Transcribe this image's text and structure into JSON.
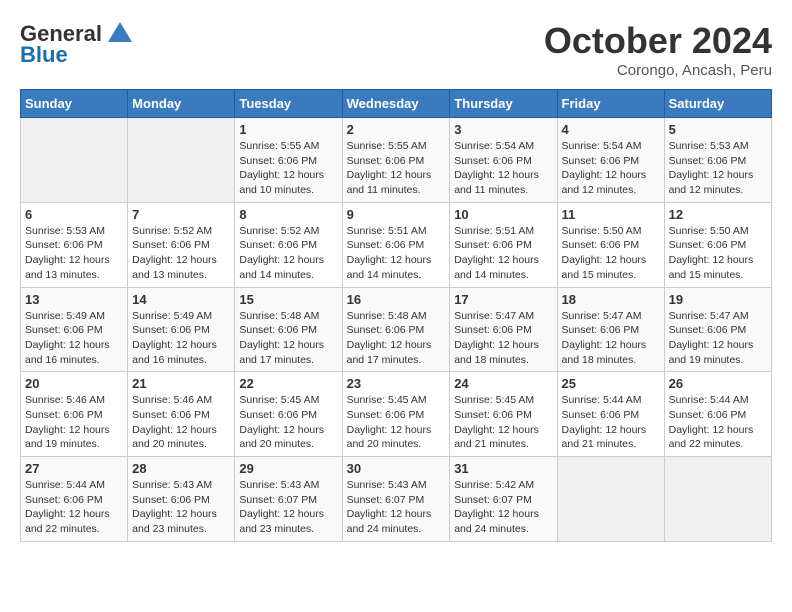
{
  "header": {
    "logo_general": "General",
    "logo_blue": "Blue",
    "month_title": "October 2024",
    "location": "Corongo, Ancash, Peru"
  },
  "weekdays": [
    "Sunday",
    "Monday",
    "Tuesday",
    "Wednesday",
    "Thursday",
    "Friday",
    "Saturday"
  ],
  "weeks": [
    [
      {
        "day": null
      },
      {
        "day": null
      },
      {
        "day": "1",
        "sunrise": "Sunrise: 5:55 AM",
        "sunset": "Sunset: 6:06 PM",
        "daylight": "Daylight: 12 hours and 10 minutes."
      },
      {
        "day": "2",
        "sunrise": "Sunrise: 5:55 AM",
        "sunset": "Sunset: 6:06 PM",
        "daylight": "Daylight: 12 hours and 11 minutes."
      },
      {
        "day": "3",
        "sunrise": "Sunrise: 5:54 AM",
        "sunset": "Sunset: 6:06 PM",
        "daylight": "Daylight: 12 hours and 11 minutes."
      },
      {
        "day": "4",
        "sunrise": "Sunrise: 5:54 AM",
        "sunset": "Sunset: 6:06 PM",
        "daylight": "Daylight: 12 hours and 12 minutes."
      },
      {
        "day": "5",
        "sunrise": "Sunrise: 5:53 AM",
        "sunset": "Sunset: 6:06 PM",
        "daylight": "Daylight: 12 hours and 12 minutes."
      }
    ],
    [
      {
        "day": "6",
        "sunrise": "Sunrise: 5:53 AM",
        "sunset": "Sunset: 6:06 PM",
        "daylight": "Daylight: 12 hours and 13 minutes."
      },
      {
        "day": "7",
        "sunrise": "Sunrise: 5:52 AM",
        "sunset": "Sunset: 6:06 PM",
        "daylight": "Daylight: 12 hours and 13 minutes."
      },
      {
        "day": "8",
        "sunrise": "Sunrise: 5:52 AM",
        "sunset": "Sunset: 6:06 PM",
        "daylight": "Daylight: 12 hours and 14 minutes."
      },
      {
        "day": "9",
        "sunrise": "Sunrise: 5:51 AM",
        "sunset": "Sunset: 6:06 PM",
        "daylight": "Daylight: 12 hours and 14 minutes."
      },
      {
        "day": "10",
        "sunrise": "Sunrise: 5:51 AM",
        "sunset": "Sunset: 6:06 PM",
        "daylight": "Daylight: 12 hours and 14 minutes."
      },
      {
        "day": "11",
        "sunrise": "Sunrise: 5:50 AM",
        "sunset": "Sunset: 6:06 PM",
        "daylight": "Daylight: 12 hours and 15 minutes."
      },
      {
        "day": "12",
        "sunrise": "Sunrise: 5:50 AM",
        "sunset": "Sunset: 6:06 PM",
        "daylight": "Daylight: 12 hours and 15 minutes."
      }
    ],
    [
      {
        "day": "13",
        "sunrise": "Sunrise: 5:49 AM",
        "sunset": "Sunset: 6:06 PM",
        "daylight": "Daylight: 12 hours and 16 minutes."
      },
      {
        "day": "14",
        "sunrise": "Sunrise: 5:49 AM",
        "sunset": "Sunset: 6:06 PM",
        "daylight": "Daylight: 12 hours and 16 minutes."
      },
      {
        "day": "15",
        "sunrise": "Sunrise: 5:48 AM",
        "sunset": "Sunset: 6:06 PM",
        "daylight": "Daylight: 12 hours and 17 minutes."
      },
      {
        "day": "16",
        "sunrise": "Sunrise: 5:48 AM",
        "sunset": "Sunset: 6:06 PM",
        "daylight": "Daylight: 12 hours and 17 minutes."
      },
      {
        "day": "17",
        "sunrise": "Sunrise: 5:47 AM",
        "sunset": "Sunset: 6:06 PM",
        "daylight": "Daylight: 12 hours and 18 minutes."
      },
      {
        "day": "18",
        "sunrise": "Sunrise: 5:47 AM",
        "sunset": "Sunset: 6:06 PM",
        "daylight": "Daylight: 12 hours and 18 minutes."
      },
      {
        "day": "19",
        "sunrise": "Sunrise: 5:47 AM",
        "sunset": "Sunset: 6:06 PM",
        "daylight": "Daylight: 12 hours and 19 minutes."
      }
    ],
    [
      {
        "day": "20",
        "sunrise": "Sunrise: 5:46 AM",
        "sunset": "Sunset: 6:06 PM",
        "daylight": "Daylight: 12 hours and 19 minutes."
      },
      {
        "day": "21",
        "sunrise": "Sunrise: 5:46 AM",
        "sunset": "Sunset: 6:06 PM",
        "daylight": "Daylight: 12 hours and 20 minutes."
      },
      {
        "day": "22",
        "sunrise": "Sunrise: 5:45 AM",
        "sunset": "Sunset: 6:06 PM",
        "daylight": "Daylight: 12 hours and 20 minutes."
      },
      {
        "day": "23",
        "sunrise": "Sunrise: 5:45 AM",
        "sunset": "Sunset: 6:06 PM",
        "daylight": "Daylight: 12 hours and 20 minutes."
      },
      {
        "day": "24",
        "sunrise": "Sunrise: 5:45 AM",
        "sunset": "Sunset: 6:06 PM",
        "daylight": "Daylight: 12 hours and 21 minutes."
      },
      {
        "day": "25",
        "sunrise": "Sunrise: 5:44 AM",
        "sunset": "Sunset: 6:06 PM",
        "daylight": "Daylight: 12 hours and 21 minutes."
      },
      {
        "day": "26",
        "sunrise": "Sunrise: 5:44 AM",
        "sunset": "Sunset: 6:06 PM",
        "daylight": "Daylight: 12 hours and 22 minutes."
      }
    ],
    [
      {
        "day": "27",
        "sunrise": "Sunrise: 5:44 AM",
        "sunset": "Sunset: 6:06 PM",
        "daylight": "Daylight: 12 hours and 22 minutes."
      },
      {
        "day": "28",
        "sunrise": "Sunrise: 5:43 AM",
        "sunset": "Sunset: 6:06 PM",
        "daylight": "Daylight: 12 hours and 23 minutes."
      },
      {
        "day": "29",
        "sunrise": "Sunrise: 5:43 AM",
        "sunset": "Sunset: 6:07 PM",
        "daylight": "Daylight: 12 hours and 23 minutes."
      },
      {
        "day": "30",
        "sunrise": "Sunrise: 5:43 AM",
        "sunset": "Sunset: 6:07 PM",
        "daylight": "Daylight: 12 hours and 24 minutes."
      },
      {
        "day": "31",
        "sunrise": "Sunrise: 5:42 AM",
        "sunset": "Sunset: 6:07 PM",
        "daylight": "Daylight: 12 hours and 24 minutes."
      },
      {
        "day": null
      },
      {
        "day": null
      }
    ]
  ]
}
